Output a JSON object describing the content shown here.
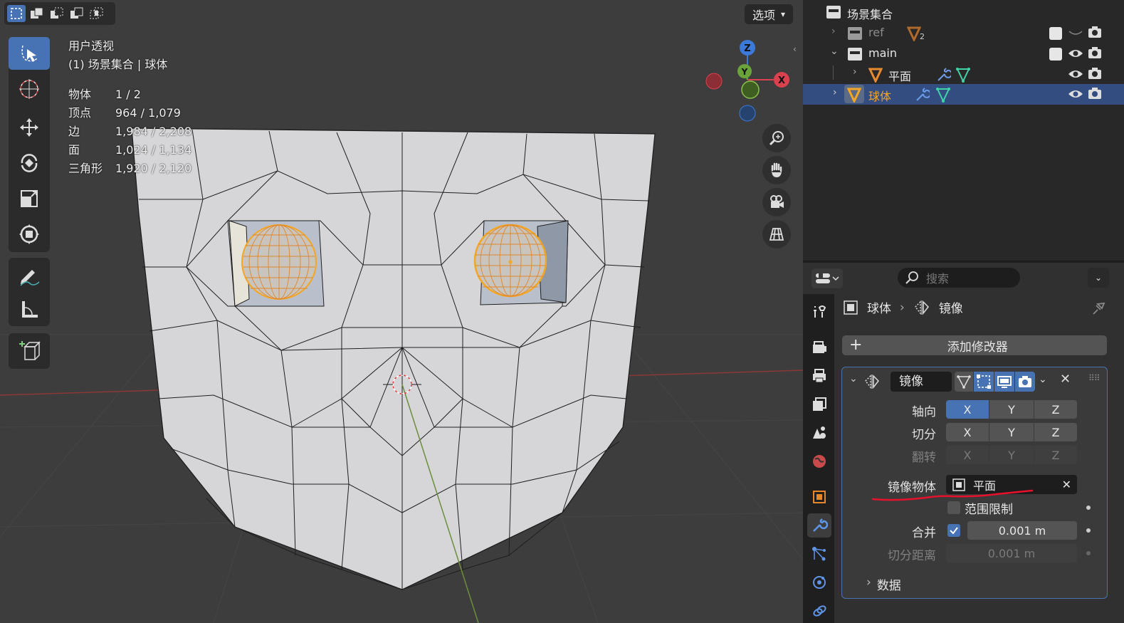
{
  "viewport": {
    "view_name": "用户透视",
    "collection_object": "(1) 场景集合 | 球体",
    "options_label": "选项",
    "stats": [
      {
        "label": "物体",
        "value": "1 / 2"
      },
      {
        "label": "顶点",
        "value": "964 / 1,079"
      },
      {
        "label": "边",
        "value": "1,984 / 2,208"
      },
      {
        "label": "面",
        "value": "1,024 / 1,134"
      },
      {
        "label": "三角形",
        "value": "1,920 / 2,120"
      }
    ],
    "gizmo_axes": {
      "z": "Z",
      "y": "Y",
      "x": "X"
    },
    "tools": [
      "select-box-icon",
      "cursor-icon",
      "move-icon",
      "rotate-icon",
      "scale-icon",
      "transform-icon",
      "annotate-icon",
      "measure-icon",
      "add-cube-icon"
    ]
  },
  "outliner": {
    "scene_collection": "场景集合",
    "items": [
      {
        "name": "ref",
        "extra": "2"
      },
      {
        "name": "main"
      },
      {
        "name": "平面"
      },
      {
        "name": "球体"
      }
    ]
  },
  "properties": {
    "search_placeholder": "搜索",
    "breadcrumb_object": "球体",
    "breadcrumb_modifier": "镜像",
    "add_modifier_label": "添加修改器",
    "modifier_name": "镜像",
    "axis_label": "轴向",
    "bisect_label": "切分",
    "flip_label": "翻转",
    "axis_x": "X",
    "axis_y": "Y",
    "axis_z": "Z",
    "mirror_object_label": "镜像物体",
    "mirror_object_value": "平面",
    "clipping_label": "范围限制",
    "merge_label": "合并",
    "merge_value": "0.001 m",
    "bisect_distance_label": "切分距离",
    "bisect_distance_value": "0.001 m",
    "data_section_label": "数据"
  },
  "colors": {
    "accent": "#4772b3",
    "selected_row": "#334d80",
    "selection_orange": "#f5a623",
    "annotation_red": "#e8102a"
  }
}
